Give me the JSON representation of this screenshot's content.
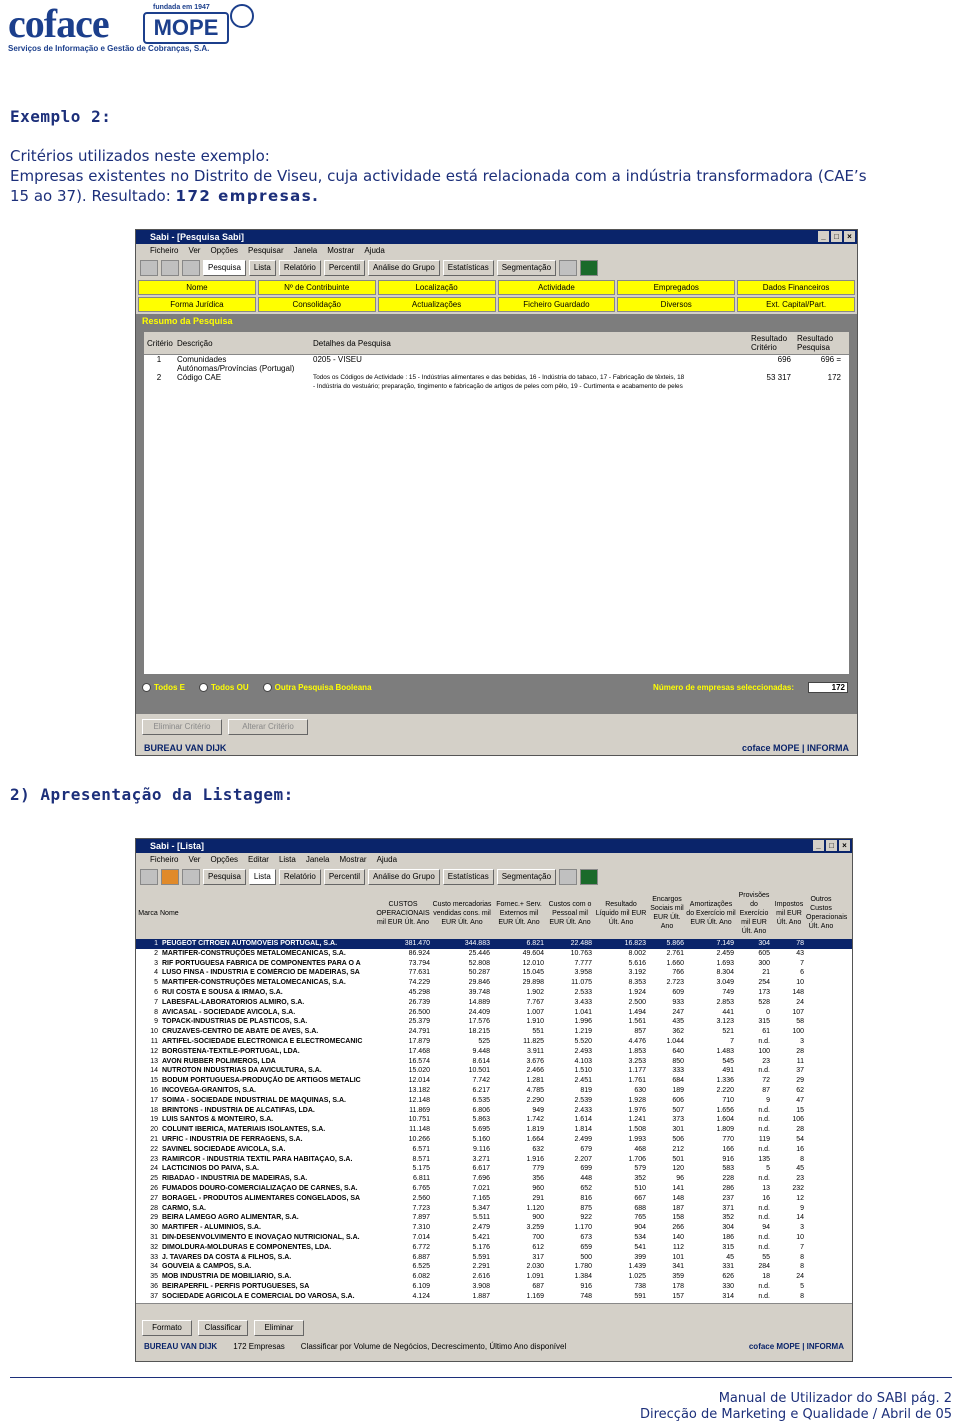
{
  "header": {
    "logo_coface": "coface",
    "logo_mope": "MOPE",
    "logo_founded": "fundada em 1947",
    "logo_tagline": "Serviços de Informação e Gestão de Cobranças, S.A."
  },
  "section1": {
    "title": "Exemplo 2:",
    "criteria_label": "Critérios utilizados neste exemplo:",
    "line1": "Empresas existentes no Distrito de Viseu, cuja actividade está relacionada com a indústria transformadora (CAE’s",
    "line2_prefix": "15 ao 37). Resultado:",
    "line2_result": "172 empresas."
  },
  "window1": {
    "title": "Sabi - [Pesquisa Sabi]",
    "menu": [
      "Ficheiro",
      "Ver",
      "Opções",
      "Pesquisar",
      "Janela",
      "Mostrar",
      "Ajuda"
    ],
    "tabs": [
      "Pesquisa",
      "Lista",
      "Relatório",
      "Percentil",
      "Análise do Grupo",
      "Estatísticas",
      "Segmentação"
    ],
    "yellow_buttons": [
      "Nome",
      "Nº de Contribuinte",
      "Localização",
      "Actividade",
      "Empregados",
      "Dados Financeiros",
      "Forma Jurídica",
      "Consolidação",
      "Actualizações",
      "Ficheiro Guardado",
      "Diversos",
      "Ext. Capital/Part."
    ],
    "resumo_title": "Resumo da Pesquisa",
    "grid_headers": {
      "criterio": "Critério",
      "descricao": "Descrição",
      "detalhes": "Detalhes da Pesquisa",
      "res_criterio": "Resultado Critério",
      "res_pesquisa": "Resultado Pesquisa"
    },
    "rows": [
      {
        "n": "1",
        "desc": "Comunidades Autónomas/Províncias (Portugal)",
        "det": "0205 - VISEU",
        "rc": "696",
        "rp": "696 ="
      },
      {
        "n": "2",
        "desc": "Código CAE",
        "det": "Todos os Códigos de Actividade : 15 - Indústrias alimentares e das bebidas, 16 - Indústria do tabaco, 17 - Fabricação de têxteis, 18",
        "det2": "- Indústria do vestuário; preparação, tingimento e fabricação de artigos de peles com pêlo, 19 - Curtimenta e acabamento de peles",
        "rc": "53 317",
        "rp": "172"
      }
    ],
    "radio_options": [
      "Todos E",
      "Todos OU",
      "Outra Pesquisa Booleana"
    ],
    "count_label": "Número de empresas seleccionadas:",
    "count_value": "172",
    "bottom_buttons": [
      "Eliminar Critério",
      "Alterar Critério"
    ],
    "footer_left": "BUREAU VAN DIJK",
    "footer_right": "coface MOPE | INFORMA"
  },
  "section2": {
    "title": "2) Apresentação da Listagem:"
  },
  "window2": {
    "title": "Sabi - [Lista]",
    "menu": [
      "Ficheiro",
      "Ver",
      "Opções",
      "Editar",
      "Lista",
      "Janela",
      "Mostrar",
      "Ajuda"
    ],
    "tabs": [
      "Pesquisa",
      "Lista",
      "Relatório",
      "Percentil",
      "Análise do Grupo",
      "Estatísticas",
      "Segmentação"
    ],
    "col_headers": [
      "Marca",
      "Nome",
      "CUSTOS OPERACIONAIS mil EUR Últ. Ano",
      "Custo mercadorias vendidas cons. mil EUR Últ. Ano",
      "Fornec.+ Serv. Externos mil EUR Últ. Ano",
      "Custos com o Pessoal mil EUR Últ. Ano",
      "Resultado Líquido mil EUR Últ. Ano",
      "Encargos Sociais mil EUR Últ. Ano",
      "Amortizações do Exercício mil EUR Últ. Ano",
      "Provisões do Exercício mil EUR Últ. Ano",
      "Impostos mil EUR Últ. Ano",
      "Outros Custos Operacionais Últ. Ano"
    ],
    "rows": [
      [
        "1",
        "PEUGEOT CITROEN AUTOMOVEIS PORTUGAL, S.A.",
        "381.470",
        "344.883",
        "6.821",
        "22.488",
        "16.823",
        "5.866",
        "7.149",
        "304",
        "78"
      ],
      [
        "2",
        "MARTIFER-CONSTRUÇÕES METALOMECANICAS, S.A.",
        "86.924",
        "25.446",
        "49.604",
        "10.763",
        "8.002",
        "2.761",
        "2.459",
        "605",
        "43"
      ],
      [
        "3",
        "RIF PORTUGUESA FABRICA DE COMPONENTES PARA O A",
        "73.794",
        "52.808",
        "12.010",
        "7.777",
        "5.616",
        "1.660",
        "1.693",
        "300",
        "7"
      ],
      [
        "4",
        "LUSO FINSA - INDUSTRIA E COMÉRCIO DE MADEIRAS, SA",
        "77.631",
        "50.287",
        "15.045",
        "3.958",
        "3.192",
        "766",
        "8.304",
        "21",
        "6"
      ],
      [
        "5",
        "MARTIFER-CONSTRUÇÕES METALOMECANICAS, S.A.",
        "74.229",
        "29.846",
        "29.898",
        "11.075",
        "8.353",
        "2.723",
        "3.049",
        "254",
        "10"
      ],
      [
        "6",
        "RUI COSTA E SOUSA & IRMAO, S.A.",
        "45.298",
        "39.748",
        "1.902",
        "2.533",
        "1.924",
        "609",
        "749",
        "173",
        "148"
      ],
      [
        "7",
        "LABESFAL-LABORATORIOS ALMIRO, S.A.",
        "26.739",
        "14.889",
        "7.767",
        "3.433",
        "2.500",
        "933",
        "2.853",
        "528",
        "24"
      ],
      [
        "8",
        "AVICASAL - SOCIEDADE AVICOLA, S.A.",
        "26.500",
        "24.409",
        "1.007",
        "1.041",
        "1.494",
        "247",
        "441",
        "0",
        "107"
      ],
      [
        "9",
        "TOPACK-INDUSTRIAS DE PLASTICOS, S.A.",
        "25.379",
        "17.576",
        "1.910",
        "1.996",
        "1.561",
        "435",
        "3.123",
        "315",
        "58"
      ],
      [
        "10",
        "CRUZAVES-CENTRO DE ABATE DE AVES, S.A.",
        "24.791",
        "18.215",
        "551",
        "1.219",
        "857",
        "362",
        "521",
        "61",
        "100"
      ],
      [
        "11",
        "ARTIFEL-SOCIEDADE ELECTRONICA E ELECTROMECANIC",
        "17.879",
        "525",
        "11.825",
        "5.520",
        "4.476",
        "1.044",
        "7",
        "n.d.",
        "3"
      ],
      [
        "12",
        "BORGSTENA-TEXTILE-PORTUGAL, LDA.",
        "17.468",
        "9.448",
        "3.911",
        "2.493",
        "1.853",
        "640",
        "1.483",
        "100",
        "28"
      ],
      [
        "13",
        "AVON RUBBER POLIMEROS, LDA",
        "16.574",
        "8.614",
        "3.676",
        "4.103",
        "3.253",
        "850",
        "545",
        "23",
        "11"
      ],
      [
        "14",
        "NUTROTON INDUSTRIAS DA AVICULTURA, S.A.",
        "15.020",
        "10.501",
        "2.466",
        "1.510",
        "1.177",
        "333",
        "491",
        "n.d.",
        "37"
      ],
      [
        "15",
        "BODUM PORTUGUESA-PRODUÇÃO DE ARTIGOS METALIC",
        "12.014",
        "7.742",
        "1.281",
        "2.451",
        "1.761",
        "684",
        "1.336",
        "72",
        "29"
      ],
      [
        "16",
        "INCOVEGA-GRANITOS, S.A.",
        "13.182",
        "6.217",
        "4.785",
        "819",
        "630",
        "189",
        "2.220",
        "87",
        "62"
      ],
      [
        "17",
        "SOIMA - SOCIEDADE INDUSTRIAL DE MAQUINAS, S.A.",
        "12.148",
        "6.535",
        "2.290",
        "2.539",
        "1.928",
        "606",
        "710",
        "9",
        "47"
      ],
      [
        "18",
        "BRINTONS - INDUSTRIA DE ALCATIFAS, LDA.",
        "11.869",
        "6.806",
        "949",
        "2.433",
        "1.976",
        "507",
        "1.656",
        "n.d.",
        "15"
      ],
      [
        "19",
        "LUIS SANTOS & MONTEIRO, S.A.",
        "10.751",
        "5.863",
        "1.742",
        "1.614",
        "1.241",
        "373",
        "1.604",
        "n.d.",
        "106"
      ],
      [
        "20",
        "COLUNIT IBERICA, MATERIAIS ISOLANTES, S.A.",
        "11.148",
        "5.695",
        "1.819",
        "1.814",
        "1.508",
        "301",
        "1.809",
        "n.d.",
        "28"
      ],
      [
        "21",
        "URFIC - INDUSTRIA DE FERRAGENS, S.A.",
        "10.266",
        "5.160",
        "1.664",
        "2.499",
        "1.993",
        "506",
        "770",
        "119",
        "54"
      ],
      [
        "22",
        "SAVINEL SOCIEDADE AVICOLA, S.A.",
        "6.571",
        "9.116",
        "632",
        "679",
        "468",
        "212",
        "166",
        "n.d.",
        "16"
      ],
      [
        "23",
        "RAMIRCOR - INDUSTRIA TEXTIL PARA HABITAÇAO, S.A.",
        "8.571",
        "3.271",
        "1.916",
        "2.207",
        "1.706",
        "501",
        "916",
        "135",
        "8"
      ],
      [
        "24",
        "LACTICINIOS DO PAIVA, S.A.",
        "5.175",
        "6.617",
        "779",
        "699",
        "579",
        "120",
        "583",
        "5",
        "45"
      ],
      [
        "25",
        "RIBADAO - INDUSTRIA DE MADEIRAS, S.A.",
        "6.811",
        "7.696",
        "356",
        "448",
        "352",
        "96",
        "228",
        "n.d.",
        "23"
      ],
      [
        "26",
        "FUMADOS DOURO-COMERCIALIZAÇAO DE CARNES, S.A.",
        "6.765",
        "7.021",
        "960",
        "652",
        "510",
        "141",
        "286",
        "13",
        "232"
      ],
      [
        "27",
        "BORAGEL - PRODUTOS ALIMENTARES CONGELADOS, SA",
        "2.560",
        "7.165",
        "291",
        "816",
        "667",
        "148",
        "237",
        "16",
        "12"
      ],
      [
        "28",
        "CARMO, S.A.",
        "7.723",
        "5.347",
        "1.120",
        "875",
        "688",
        "187",
        "371",
        "n.d.",
        "9"
      ],
      [
        "29",
        "BEIRA LAMEGO AGRO ALIMENTAR, S.A.",
        "7.897",
        "5.511",
        "900",
        "922",
        "765",
        "158",
        "352",
        "n.d.",
        "14"
      ],
      [
        "30",
        "MARTIFER - ALUMINIOS, S.A.",
        "7.310",
        "2.479",
        "3.259",
        "1.170",
        "904",
        "266",
        "304",
        "94",
        "3"
      ],
      [
        "31",
        "DIN-DESENVOLVIMENTO E INOVAÇAO NUTRICIONAL, S.A.",
        "7.014",
        "5.421",
        "700",
        "673",
        "534",
        "140",
        "186",
        "n.d.",
        "10"
      ],
      [
        "32",
        "DIMOLDURA-MOLDURAS E COMPONENTES, LDA.",
        "6.772",
        "5.176",
        "612",
        "659",
        "541",
        "112",
        "315",
        "n.d.",
        "7"
      ],
      [
        "33",
        "J. TAVARES DA COSTA & FILHOS, S.A.",
        "6.887",
        "5.591",
        "317",
        "500",
        "399",
        "101",
        "45",
        "55",
        "8"
      ],
      [
        "34",
        "GOUVEIA & CAMPOS, S.A.",
        "6.525",
        "2.291",
        "2.030",
        "1.780",
        "1.439",
        "341",
        "331",
        "284",
        "8"
      ],
      [
        "35",
        "MOB INDUSTRIA DE MOBILIARIO, S.A.",
        "6.082",
        "2.616",
        "1.091",
        "1.384",
        "1.025",
        "359",
        "626",
        "18",
        "24"
      ],
      [
        "36",
        "BEIRAPERFIL - PERFIS PORTUGUESES, SA",
        "6.109",
        "3.908",
        "687",
        "916",
        "738",
        "178",
        "330",
        "n.d.",
        "5"
      ],
      [
        "37",
        "SOCIEDADE AGRICOLA E COMERCIAL DO VAROSA, S.A.",
        "4.124",
        "1.887",
        "1.169",
        "748",
        "591",
        "157",
        "314",
        "n.d.",
        "8"
      ]
    ],
    "bottom_buttons": [
      "Formato",
      "Classificar",
      "Eliminar"
    ],
    "footer_left": "BUREAU VAN DIJK",
    "footer_count": "172 Empresas",
    "footer_sort": "Classificar por Volume de Negócios, Decrescimento, Último Ano disponível",
    "footer_right": "coface MOPE | INFORMA"
  },
  "footer": {
    "manual": "Manual de Utilizador do SABI pág. 2",
    "department": "Direcção de Marketing e Qualidade / Abril de 05"
  }
}
